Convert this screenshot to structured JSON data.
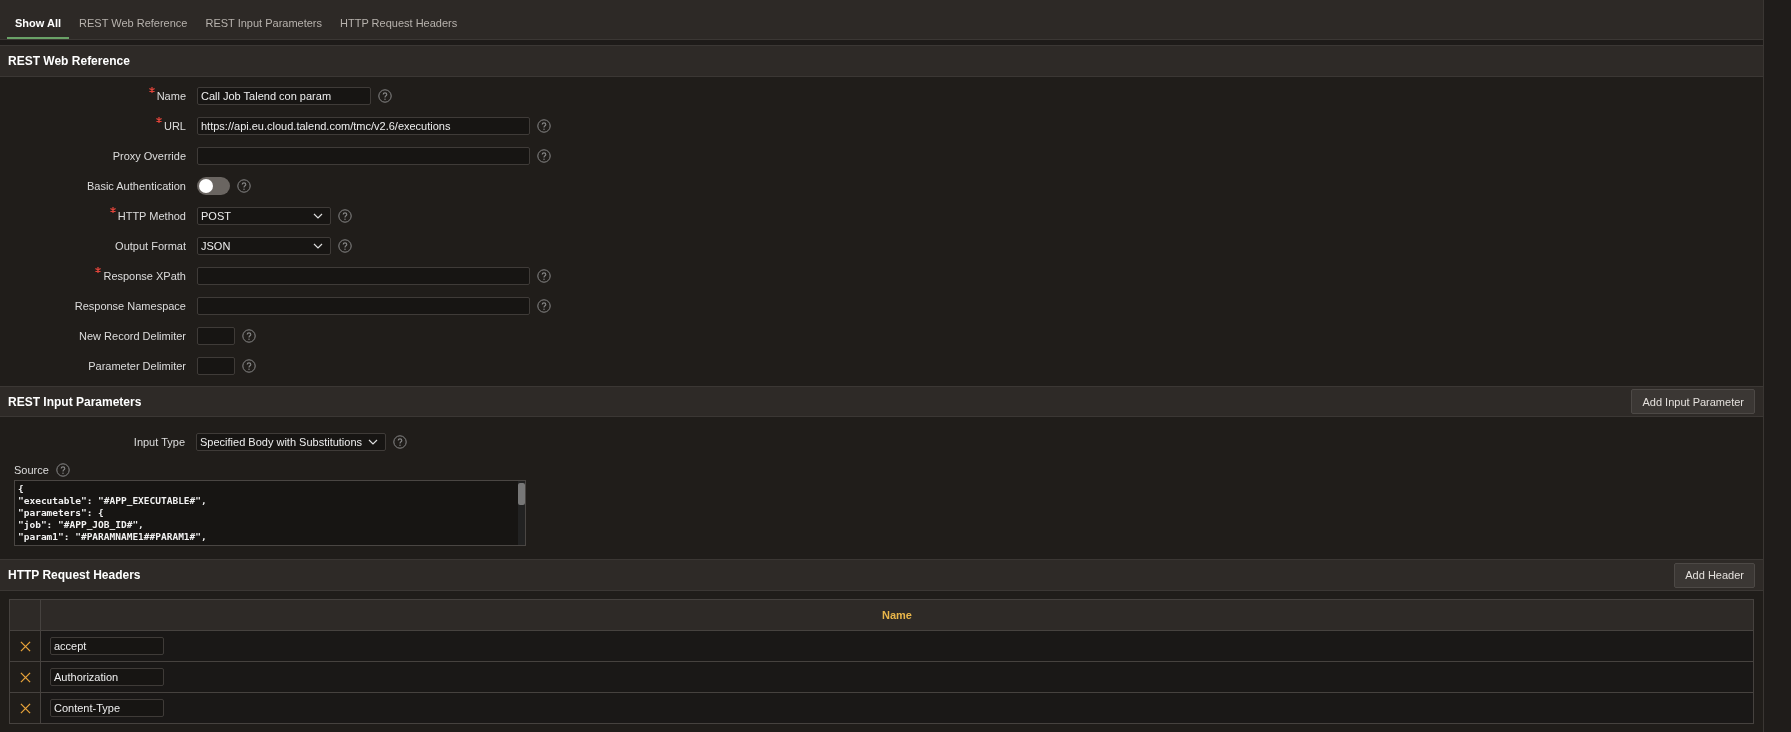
{
  "tabs": [
    {
      "label": "Show All",
      "selected": true
    },
    {
      "label": "REST Web Reference",
      "selected": false
    },
    {
      "label": "REST Input Parameters",
      "selected": false
    },
    {
      "label": "HTTP Request Headers",
      "selected": false
    }
  ],
  "web_reference": {
    "title": "REST Web Reference",
    "fields": [
      {
        "label": "Name",
        "required": true,
        "kind": "text",
        "value": "Call Job Talend con param"
      },
      {
        "label": "URL",
        "required": true,
        "kind": "long_text",
        "value": "https://api.eu.cloud.talend.com/tmc/v2.6/executions"
      },
      {
        "label": "Proxy Override",
        "required": false,
        "kind": "long_text"
      },
      {
        "label": "Basic Authentication",
        "required": false,
        "kind": "toggle",
        "on": false
      },
      {
        "label": "HTTP Method",
        "required": true,
        "kind": "select",
        "value": "POST"
      },
      {
        "label": "Output Format",
        "required": false,
        "kind": "select",
        "value": "JSON"
      },
      {
        "label": "Response XPath",
        "required": true,
        "kind": "long_text"
      },
      {
        "label": "Response Namespace",
        "required": false,
        "kind": "long_text"
      },
      {
        "label": "New Record Delimiter",
        "required": false,
        "kind": "short_text"
      },
      {
        "label": "Parameter Delimiter",
        "required": false,
        "kind": "short_text"
      }
    ]
  },
  "input_parameters": {
    "title": "REST Input Parameters",
    "button": "Add Input Parameter",
    "input_type": {
      "label": "Input Type",
      "value": "Specified Body with Substitutions"
    },
    "source": {
      "label": "Source",
      "lines": [
        "{",
        "\"executable\": \"#APP_EXECUTABLE#\",",
        "\"parameters\": {",
        "\"job\": \"#APP_JOB_ID#\",",
        "\"param1\": \"#PARAMNAME1##PARAM1#\","
      ]
    }
  },
  "request_headers": {
    "title": "HTTP Request Headers",
    "button": "Add Header",
    "columns": [
      "Name"
    ],
    "rows": [
      {
        "value": "accept"
      },
      {
        "value": "Authorization"
      },
      {
        "value": "Content-Type"
      }
    ]
  }
}
